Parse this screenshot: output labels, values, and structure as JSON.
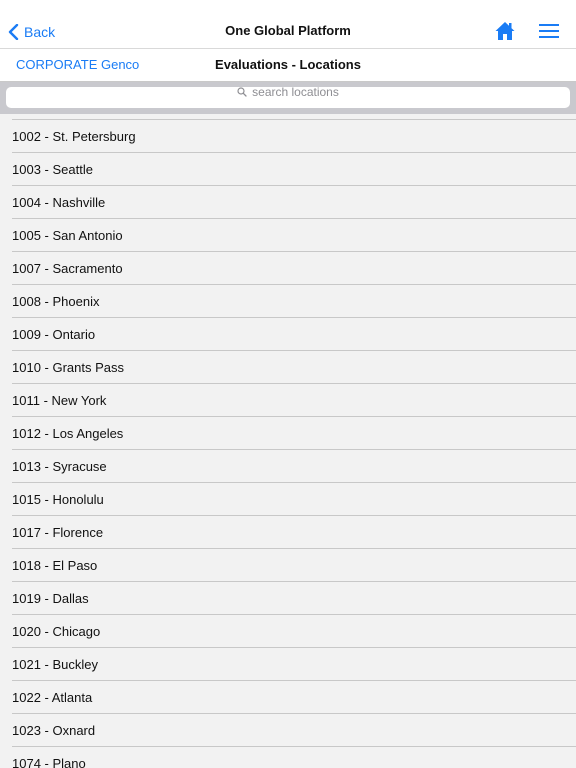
{
  "header": {
    "back_label": "Back",
    "title": "One Global Platform",
    "icons": [
      "chevron-left-icon",
      "home-icon",
      "menu-icon"
    ],
    "accent_color": "#1a7cf5"
  },
  "subheader": {
    "company": "CORPORATE Genco",
    "title": "Evaluations - Locations"
  },
  "search": {
    "placeholder": "search locations",
    "value": ""
  },
  "locations": [
    "1002 - St. Petersburg",
    "1003 - Seattle",
    "1004 - Nashville",
    "1005 - San Antonio",
    "1007 - Sacramento",
    "1008 - Phoenix",
    "1009 - Ontario",
    "1010 - Grants Pass",
    "1011 - New York",
    "1012 - Los Angeles",
    "1013 - Syracuse",
    "1015 - Honolulu",
    "1017 - Florence",
    "1018 - El Paso",
    "1019 - Dallas",
    "1020 - Chicago",
    "1021 - Buckley",
    "1022 - Atlanta",
    "1023 - Oxnard",
    "1074 - Plano"
  ]
}
